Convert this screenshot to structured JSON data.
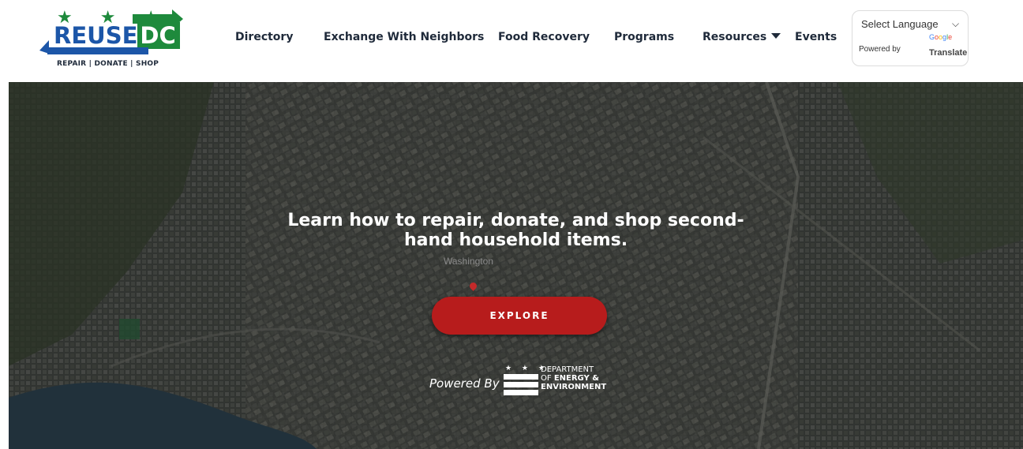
{
  "logo": {
    "stars": "★ ★ ★",
    "word_reuse": "REUSE",
    "word_dc": "DC",
    "tagline": "REPAIR | DONATE | SHOP",
    "colors": {
      "green": "#1e8a3c",
      "blue": "#1c56a8"
    }
  },
  "nav": {
    "items": [
      {
        "label": "Directory"
      },
      {
        "label": "Exchange With Neighbors"
      },
      {
        "label": "Food Recovery"
      },
      {
        "label": "Programs"
      },
      {
        "label": "Resources"
      },
      {
        "label": "Events"
      }
    ],
    "resources_icon": "caret-down-icon"
  },
  "translate": {
    "select_label": "Select Language",
    "chevron": "⌵",
    "powered_by": "Powered by",
    "google": "Google",
    "translate": "Translate"
  },
  "hero": {
    "headline_line1": "Learn how to repair, donate, and shop second-",
    "headline_line2": "hand household items.",
    "map_label": "Washington",
    "explore_label": "EXPLORE",
    "powered_by": "Powered By",
    "explore_color": "#b71c1c"
  },
  "doee": {
    "stars": "★ ★ ★",
    "line1": "DEPARTMENT",
    "line2_prefix": "OF ",
    "line2_bold": "ENERGY &",
    "line3": "ENVIRONMENT"
  }
}
